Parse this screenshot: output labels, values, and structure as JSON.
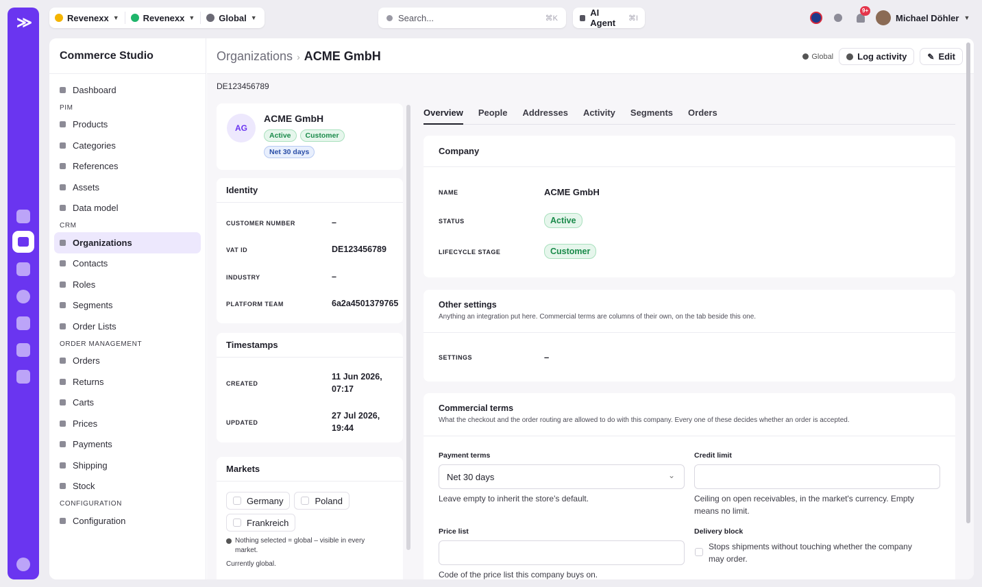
{
  "app": {
    "logo": "≫",
    "brand": "Commerce Studio"
  },
  "topbar": {
    "org": "Revenexx",
    "store": "Revenexx",
    "scope": "Global",
    "search_placeholder": "Search...",
    "search_shortcut": "⌘K",
    "ai_agent": "AI Agent",
    "ai_shortcut": "⌘I",
    "notifications_badge": "9+",
    "user": "Michael Döhler"
  },
  "sidebar": {
    "items": [
      {
        "type": "item",
        "label": "Dashboard",
        "icon": "dashboard-icon"
      },
      {
        "type": "section",
        "label": "PIM"
      },
      {
        "type": "item",
        "label": "Products",
        "icon": "products-icon"
      },
      {
        "type": "item",
        "label": "Categories",
        "icon": "categories-icon"
      },
      {
        "type": "item",
        "label": "References",
        "icon": "references-icon"
      },
      {
        "type": "item",
        "label": "Assets",
        "icon": "assets-icon"
      },
      {
        "type": "item",
        "label": "Data model",
        "icon": "data-model-icon"
      },
      {
        "type": "section",
        "label": "CRM"
      },
      {
        "type": "item",
        "label": "Organizations",
        "icon": "organizations-icon",
        "active": true
      },
      {
        "type": "item",
        "label": "Contacts",
        "icon": "contacts-icon"
      },
      {
        "type": "item",
        "label": "Roles",
        "icon": "roles-icon"
      },
      {
        "type": "item",
        "label": "Segments",
        "icon": "segments-icon"
      },
      {
        "type": "item",
        "label": "Order Lists",
        "icon": "order-lists-icon"
      },
      {
        "type": "section",
        "label": "ORDER MANAGEMENT"
      },
      {
        "type": "item",
        "label": "Orders",
        "icon": "orders-icon"
      },
      {
        "type": "item",
        "label": "Returns",
        "icon": "returns-icon"
      },
      {
        "type": "item",
        "label": "Carts",
        "icon": "carts-icon"
      },
      {
        "type": "item",
        "label": "Prices",
        "icon": "prices-icon"
      },
      {
        "type": "item",
        "label": "Payments",
        "icon": "payments-icon"
      },
      {
        "type": "item",
        "label": "Shipping",
        "icon": "shipping-icon"
      },
      {
        "type": "item",
        "label": "Stock",
        "icon": "stock-icon"
      },
      {
        "type": "section",
        "label": "CONFIGURATION"
      },
      {
        "type": "item",
        "label": "Configuration",
        "icon": "configuration-icon"
      }
    ]
  },
  "header": {
    "crumb_parent": "Organizations",
    "crumb_sep": "›",
    "title": "ACME GmbH",
    "scope": "Global",
    "log_activity": "Log activity",
    "edit": "Edit"
  },
  "vat_line": "DE123456789",
  "summary": {
    "initials": "AG",
    "name": "ACME GmbH",
    "badges": [
      "Active",
      "Customer",
      "Net 30 days"
    ]
  },
  "identity": {
    "title": "Identity",
    "rows": [
      {
        "label": "CUSTOMER NUMBER",
        "value": "–"
      },
      {
        "label": "VAT ID",
        "value": "DE123456789"
      },
      {
        "label": "INDUSTRY",
        "value": "–"
      },
      {
        "label": "PLATFORM TEAM",
        "value": "6a2a4501379765"
      }
    ]
  },
  "timestamps": {
    "title": "Timestamps",
    "rows": [
      {
        "label": "CREATED",
        "value1": "11 Jun 2026,",
        "value2": "07:17"
      },
      {
        "label": "UPDATED",
        "value1": "27 Jul 2026,",
        "value2": "19:44"
      }
    ]
  },
  "markets": {
    "title": "Markets",
    "options": [
      "Germany",
      "Poland",
      "Frankreich"
    ],
    "note": "Nothing selected = global – visible in every market.",
    "current": "Currently global."
  },
  "tabs": [
    "Overview",
    "People",
    "Addresses",
    "Activity",
    "Segments",
    "Orders"
  ],
  "company": {
    "title": "Company",
    "rows": [
      {
        "label": "NAME",
        "value": "ACME GmbH"
      },
      {
        "label": "STATUS",
        "value": "Active"
      },
      {
        "label": "LIFECYCLE STAGE",
        "value": "Customer"
      }
    ]
  },
  "other": {
    "title": "Other settings",
    "subtitle": "Anything an integration put here. Commercial terms are columns of their own, on the tab beside this one.",
    "settings_label": "SETTINGS",
    "settings_value": "–"
  },
  "commercial": {
    "title": "Commercial terms",
    "subtitle": "What the checkout and the order routing are allowed to do with this company. Every one of these decides whether an order is accepted.",
    "payment_label": "Payment terms",
    "payment_value": "Net 30 days",
    "payment_help": "Leave empty to inherit the store's default.",
    "credit_label": "Credit limit",
    "credit_help1": "Ceiling on open receivables, in the market's currency. Empty",
    "credit_help2": "means no limit.",
    "price_label": "Price list",
    "price_help": "Code of the price list this company buys on.",
    "delivery_label": "Delivery block",
    "delivery_help1": "Stops shipments without touching whether the company",
    "delivery_help2": "may order."
  },
  "colors": {
    "accent": "#6a35f0",
    "active_bg": "#ede8fd",
    "green": "#1a8a4a",
    "blue": "#2b4fa8",
    "badge_red": "#e5354b"
  }
}
